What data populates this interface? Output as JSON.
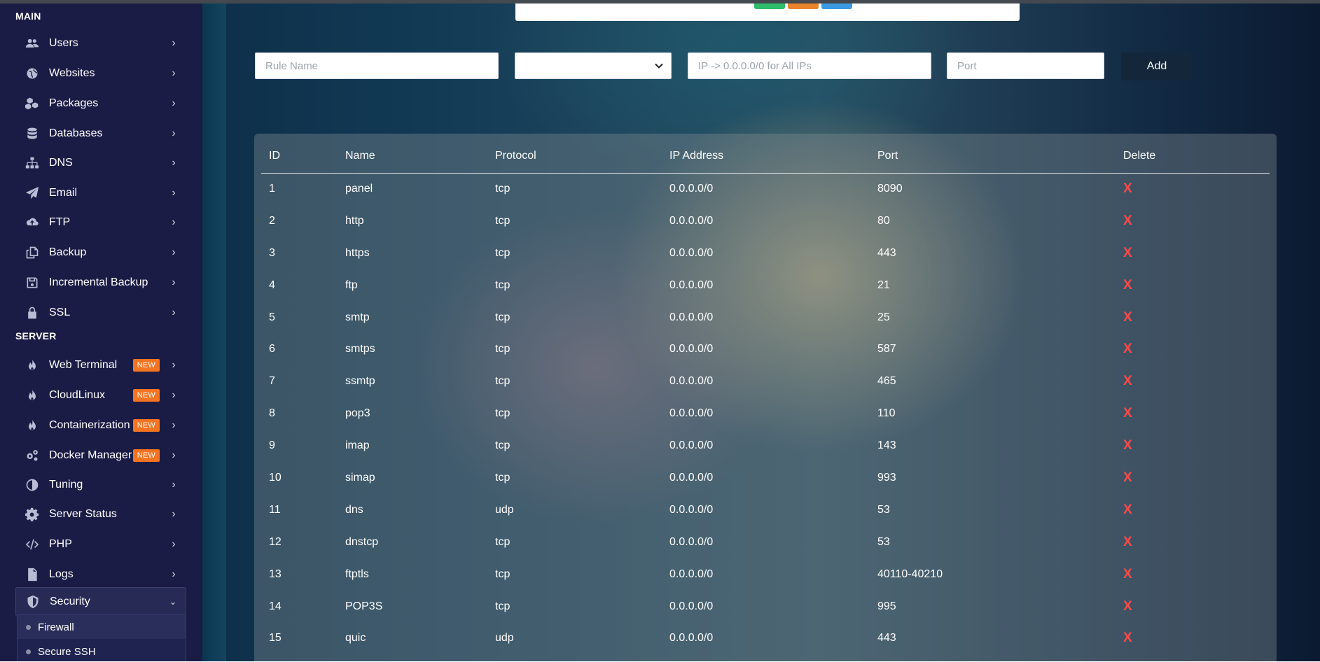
{
  "sidebar": {
    "main_title": "MAIN",
    "server_title": "SERVER",
    "main_items": [
      {
        "label": "Users",
        "icon": "users-icon"
      },
      {
        "label": "Websites",
        "icon": "globe-icon"
      },
      {
        "label": "Packages",
        "icon": "cubes-icon"
      },
      {
        "label": "Databases",
        "icon": "database-icon"
      },
      {
        "label": "DNS",
        "icon": "sitemap-icon"
      },
      {
        "label": "Email",
        "icon": "paper-plane-icon"
      },
      {
        "label": "FTP",
        "icon": "cloud-upload-icon"
      },
      {
        "label": "Backup",
        "icon": "copy-icon"
      },
      {
        "label": "Incremental Backup",
        "icon": "save-icon"
      },
      {
        "label": "SSL",
        "icon": "lock-icon"
      }
    ],
    "server_items": [
      {
        "label": "Web Terminal",
        "icon": "flame-icon",
        "badge": "NEW"
      },
      {
        "label": "CloudLinux",
        "icon": "flame-icon",
        "badge": "NEW"
      },
      {
        "label": "Containerization",
        "icon": "flame-icon",
        "badge": "NEW"
      },
      {
        "label": "Docker Manager",
        "icon": "gears-icon",
        "badge": "NEW"
      },
      {
        "label": "Tuning",
        "icon": "half-circle-icon"
      },
      {
        "label": "Server Status",
        "icon": "gear-icon"
      },
      {
        "label": "PHP",
        "icon": "code-icon"
      },
      {
        "label": "Logs",
        "icon": "file-icon"
      },
      {
        "label": "Security",
        "icon": "shield-icon"
      }
    ],
    "security_sub": [
      {
        "label": "Firewall"
      },
      {
        "label": "Secure SSH"
      }
    ]
  },
  "form": {
    "rule_name_placeholder": "Rule Name",
    "ip_placeholder": "IP -> 0.0.0.0/0 for All IPs",
    "port_placeholder": "Port",
    "add_label": "Add"
  },
  "colors": {
    "pill_green": "#2ebd6b",
    "pill_orange": "#e8832c",
    "pill_blue": "#3b9ae1",
    "delete": "#ff4a4a",
    "badge": "#f47421"
  },
  "table": {
    "headers": [
      "ID",
      "Name",
      "Protocol",
      "IP Address",
      "Port",
      "Delete"
    ],
    "delete_symbol": "X",
    "rows": [
      {
        "id": "1",
        "name": "panel",
        "protocol": "tcp",
        "ip": "0.0.0.0/0",
        "port": "8090"
      },
      {
        "id": "2",
        "name": "http",
        "protocol": "tcp",
        "ip": "0.0.0.0/0",
        "port": "80"
      },
      {
        "id": "3",
        "name": "https",
        "protocol": "tcp",
        "ip": "0.0.0.0/0",
        "port": "443"
      },
      {
        "id": "4",
        "name": "ftp",
        "protocol": "tcp",
        "ip": "0.0.0.0/0",
        "port": "21"
      },
      {
        "id": "5",
        "name": "smtp",
        "protocol": "tcp",
        "ip": "0.0.0.0/0",
        "port": "25"
      },
      {
        "id": "6",
        "name": "smtps",
        "protocol": "tcp",
        "ip": "0.0.0.0/0",
        "port": "587"
      },
      {
        "id": "7",
        "name": "ssmtp",
        "protocol": "tcp",
        "ip": "0.0.0.0/0",
        "port": "465"
      },
      {
        "id": "8",
        "name": "pop3",
        "protocol": "tcp",
        "ip": "0.0.0.0/0",
        "port": "110"
      },
      {
        "id": "9",
        "name": "imap",
        "protocol": "tcp",
        "ip": "0.0.0.0/0",
        "port": "143"
      },
      {
        "id": "10",
        "name": "simap",
        "protocol": "tcp",
        "ip": "0.0.0.0/0",
        "port": "993"
      },
      {
        "id": "11",
        "name": "dns",
        "protocol": "udp",
        "ip": "0.0.0.0/0",
        "port": "53"
      },
      {
        "id": "12",
        "name": "dnstcp",
        "protocol": "tcp",
        "ip": "0.0.0.0/0",
        "port": "53"
      },
      {
        "id": "13",
        "name": "ftptls",
        "protocol": "tcp",
        "ip": "0.0.0.0/0",
        "port": "40110-40210"
      },
      {
        "id": "14",
        "name": "POP3S",
        "protocol": "tcp",
        "ip": "0.0.0.0/0",
        "port": "995"
      },
      {
        "id": "15",
        "name": "quic",
        "protocol": "udp",
        "ip": "0.0.0.0/0",
        "port": "443"
      }
    ]
  }
}
